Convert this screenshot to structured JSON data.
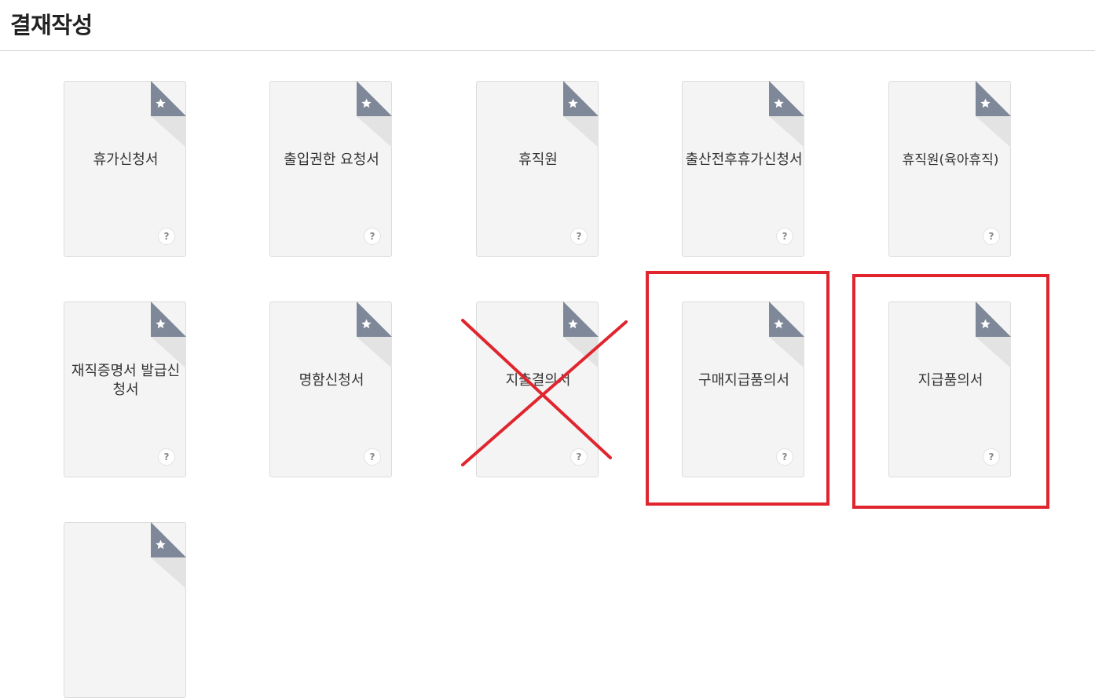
{
  "page": {
    "title": "결재작성"
  },
  "forms": [
    {
      "label": "휴가신청서",
      "help": "?"
    },
    {
      "label": "출입권한 요청서",
      "help": "?"
    },
    {
      "label": "휴직원",
      "help": "?"
    },
    {
      "label": "출산전후휴가신청서",
      "help": "?"
    },
    {
      "label": "휴직원(육아휴직)",
      "help": "?"
    },
    {
      "label": "재직증명서 발급신청서",
      "help": "?"
    },
    {
      "label": "명함신청서",
      "help": "?"
    },
    {
      "label": "지출결의서",
      "help": "?"
    },
    {
      "label": "구매지급품의서",
      "help": "?"
    },
    {
      "label": "지급품의서",
      "help": "?"
    },
    {
      "label": "",
      "help": ""
    }
  ],
  "icons": {
    "favorite": "star-icon",
    "help": "help-icon"
  },
  "colors": {
    "annotation": "#e0252f",
    "corner": "#7e8899",
    "card": "#f4f4f4"
  }
}
